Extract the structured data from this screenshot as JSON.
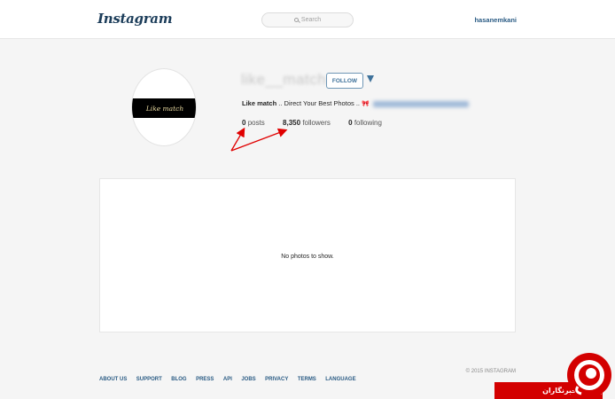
{
  "header": {
    "logo_text": "Instagram",
    "search_placeholder": "Search",
    "username": "hasanemkani"
  },
  "profile": {
    "avatar_text": "Like match",
    "name": "like__match",
    "follow_label": "FOLLOW",
    "bio_name": "Like match",
    "bio_text": " .. Direct Your Best Photos .. ",
    "stats": {
      "posts_count": "0",
      "posts_label": "posts",
      "followers_count": "8,350",
      "followers_label": "followers",
      "following_count": "0",
      "following_label": "following"
    }
  },
  "main": {
    "empty_message": "No photos to show."
  },
  "footer": {
    "links": [
      "ABOUT US",
      "SUPPORT",
      "BLOG",
      "PRESS",
      "API",
      "JOBS",
      "PRIVACY",
      "TERMS",
      "LANGUAGE"
    ],
    "copyright": "© 2015 INSTAGRAM"
  },
  "watermark": {
    "text": "باشگاه خبرنگاران"
  },
  "colors": {
    "accent_blue": "#3f729b",
    "link_blue": "#2a5b84",
    "arrow_red": "#e00000",
    "watermark_red": "#d30000"
  }
}
